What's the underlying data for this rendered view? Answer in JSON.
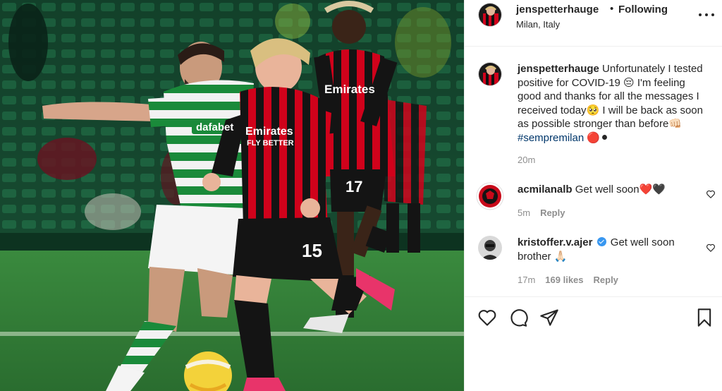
{
  "post": {
    "author": "jenspetterhauge",
    "follow_separator": "•",
    "follow_status": "Following",
    "location": "Milan, Italy",
    "more_icon": "more-horizontal-icon"
  },
  "photo": {
    "alt_subject": "football match",
    "kit_text": {
      "milan_sponsor_front": "Emirates",
      "milan_sponsor_front_2": "FLY BETTER",
      "milan_sponsor_back": "Emirates",
      "celtic_sponsor": "dafabet",
      "shirt_number_front": "15",
      "shirt_number_back": "17"
    }
  },
  "caption": {
    "username": "jenspetterhauge",
    "text_1": "Unfortunately I tested positive for COVID-19 😔 I'm feeling good and thanks for all the messages I received today🥺 I will be back as soon as possible stronger than before👊🏻 ",
    "hashtag": "#sempremilan",
    "text_2": " 🔴⚫",
    "time": "20m"
  },
  "comments": [
    {
      "username": "acmilanalb",
      "text": "Get well soon❤️🖤",
      "time": "5m",
      "likes": "",
      "reply_label": "Reply"
    },
    {
      "username": "kristoffer.v.ajer",
      "verified": true,
      "text": "Get well soon brother 🙏🏻",
      "time": "17m",
      "likes": "169 likes",
      "reply_label": "Reply"
    }
  ],
  "actions": {
    "like_icon": "heart-icon",
    "comment_icon": "comment-icon",
    "share_icon": "share-icon",
    "save_icon": "bookmark-icon"
  },
  "colors": {
    "milan_red": "#d0021b",
    "celtic_green": "#1a8a3a",
    "pitch": "#2f7d3a",
    "text": "#262626",
    "muted": "#8e8e8e",
    "link": "#00376b",
    "verified": "#3897f0"
  }
}
